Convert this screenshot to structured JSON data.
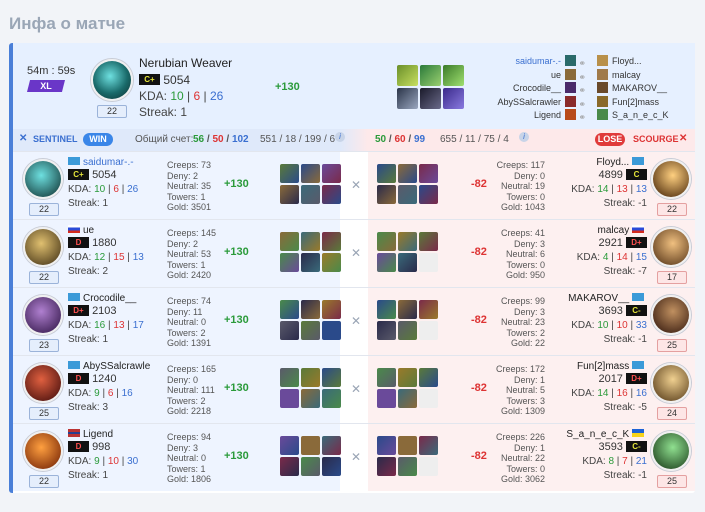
{
  "page": {
    "title": "Инфа о матче"
  },
  "match": {
    "duration": "54m : 59s",
    "size_badge": "XL",
    "mvp": {
      "name": "Nerubian Weaver",
      "rank": "C+",
      "mmr": "5054",
      "kda_label": "KDA:",
      "k": "10",
      "d": "6",
      "a": "26",
      "streak": "Streak: 1",
      "level": "22",
      "gain": "+130"
    },
    "players_left": [
      "saidumar-.-",
      "ue",
      "Crocodile__",
      "AbySSalcrawler",
      "Ligend"
    ],
    "players_right": [
      "Floyd...",
      "malcay",
      "MAKAROV__",
      "Fun[2]mass",
      "S_a_n_e_c_K"
    ]
  },
  "scorebar": {
    "sentinel": "SENTINEL",
    "win": "WIN",
    "total_label": "Общий счет:",
    "left_k": "56",
    "left_d": "50",
    "left_a": "102",
    "left_stats": "551 / 18 / 199 / 6",
    "right_k": "50",
    "right_d": "60",
    "right_a": "99",
    "right_stats": "655 / 11 / 75 / 4",
    "lose": "LOSE",
    "scourge": "SCOURGE"
  },
  "rows": [
    {
      "l": {
        "name": "saidumar-.-",
        "rank": "C+",
        "mmr": "5054",
        "k": "10",
        "d": "6",
        "a": "26",
        "streak": "Streak: 1",
        "level": "22",
        "creeps": "Creeps: 73",
        "deny": "Deny: 2",
        "neutral": "Neutral: 35",
        "towers": "Towers: 1",
        "gold": "Gold: 3501",
        "delta": "+130"
      },
      "r": {
        "name": "Floyd...",
        "rank": "C",
        "mmr": "4899",
        "k": "14",
        "d": "13",
        "a": "13",
        "streak": "Streak: -1",
        "level": "22",
        "creeps": "Creeps: 117",
        "deny": "Deny: 0",
        "neutral": "Neutral: 19",
        "towers": "Towers: 0",
        "gold": "Gold: 1043",
        "delta": "-82"
      }
    },
    {
      "l": {
        "name": "ue",
        "rank": "D",
        "mmr": "1880",
        "k": "12",
        "d": "15",
        "a": "13",
        "streak": "Streak: 2",
        "level": "22",
        "creeps": "Creeps: 145",
        "deny": "Deny: 2",
        "neutral": "Neutral: 53",
        "towers": "Towers: 1",
        "gold": "Gold: 2420",
        "delta": "+130"
      },
      "r": {
        "name": "malcay",
        "rank": "D+",
        "mmr": "2921",
        "k": "4",
        "d": "14",
        "a": "15",
        "streak": "Streak: -7",
        "level": "17",
        "creeps": "Creeps: 41",
        "deny": "Deny: 3",
        "neutral": "Neutral: 6",
        "towers": "Towers: 0",
        "gold": "Gold: 950",
        "delta": "-82"
      }
    },
    {
      "l": {
        "name": "Crocodile__",
        "rank": "D+",
        "mmr": "2103",
        "k": "16",
        "d": "13",
        "a": "17",
        "streak": "Streak: 1",
        "level": "23",
        "creeps": "Creeps: 74",
        "deny": "Deny: 11",
        "neutral": "Neutral: 0",
        "towers": "Towers: 2",
        "gold": "Gold: 1391",
        "delta": "+130"
      },
      "r": {
        "name": "MAKAROV__",
        "rank": "C-",
        "mmr": "3693",
        "k": "10",
        "d": "10",
        "a": "33",
        "streak": "Streak: -1",
        "level": "25",
        "creeps": "Creeps: 99",
        "deny": "Deny: 3",
        "neutral": "Neutral: 23",
        "towers": "Towers: 2",
        "gold": "Gold: 22",
        "delta": "-82"
      }
    },
    {
      "l": {
        "name": "AbySSalcrawler",
        "rank": "D",
        "mmr": "1240",
        "k": "9",
        "d": "6",
        "a": "16",
        "streak": "Streak: 3",
        "level": "25",
        "creeps": "Creeps: 165",
        "deny": "Deny: 0",
        "neutral": "Neutral: 111",
        "towers": "Towers: 2",
        "gold": "Gold: 2218",
        "delta": "+130"
      },
      "r": {
        "name": "Fun[2]mass",
        "rank": "D+",
        "mmr": "2017",
        "k": "14",
        "d": "16",
        "a": "16",
        "streak": "Streak: -5",
        "level": "24",
        "creeps": "Creeps: 172",
        "deny": "Deny: 1",
        "neutral": "Neutral: 5",
        "towers": "Towers: 3",
        "gold": "Gold: 1309",
        "delta": "-82"
      }
    },
    {
      "l": {
        "name": "Ligend",
        "rank": "D",
        "mmr": "998",
        "k": "9",
        "d": "10",
        "a": "30",
        "streak": "Streak: 1",
        "level": "22",
        "creeps": "Creeps: 94",
        "deny": "Deny: 3",
        "neutral": "Neutral: 0",
        "towers": "Towers: 1",
        "gold": "Gold: 1806",
        "delta": "+130"
      },
      "r": {
        "name": "S_a_n_e_c_K",
        "rank": "C-",
        "mmr": "3593",
        "k": "8",
        "d": "7",
        "a": "21",
        "streak": "Streak: -1",
        "level": "25",
        "creeps": "Creeps: 226",
        "deny": "Deny: 1",
        "neutral": "Neutral: 22",
        "towers": "Towers: 0",
        "gold": "Gold: 3062",
        "delta": "-82"
      }
    }
  ],
  "colors": {
    "accent": "#4a7fd8",
    "win": "#3a86e8",
    "lose": "#e03a3a",
    "kills": "#2a9a3a",
    "deaths": "#dd3333",
    "assists": "#3a6fd0"
  }
}
